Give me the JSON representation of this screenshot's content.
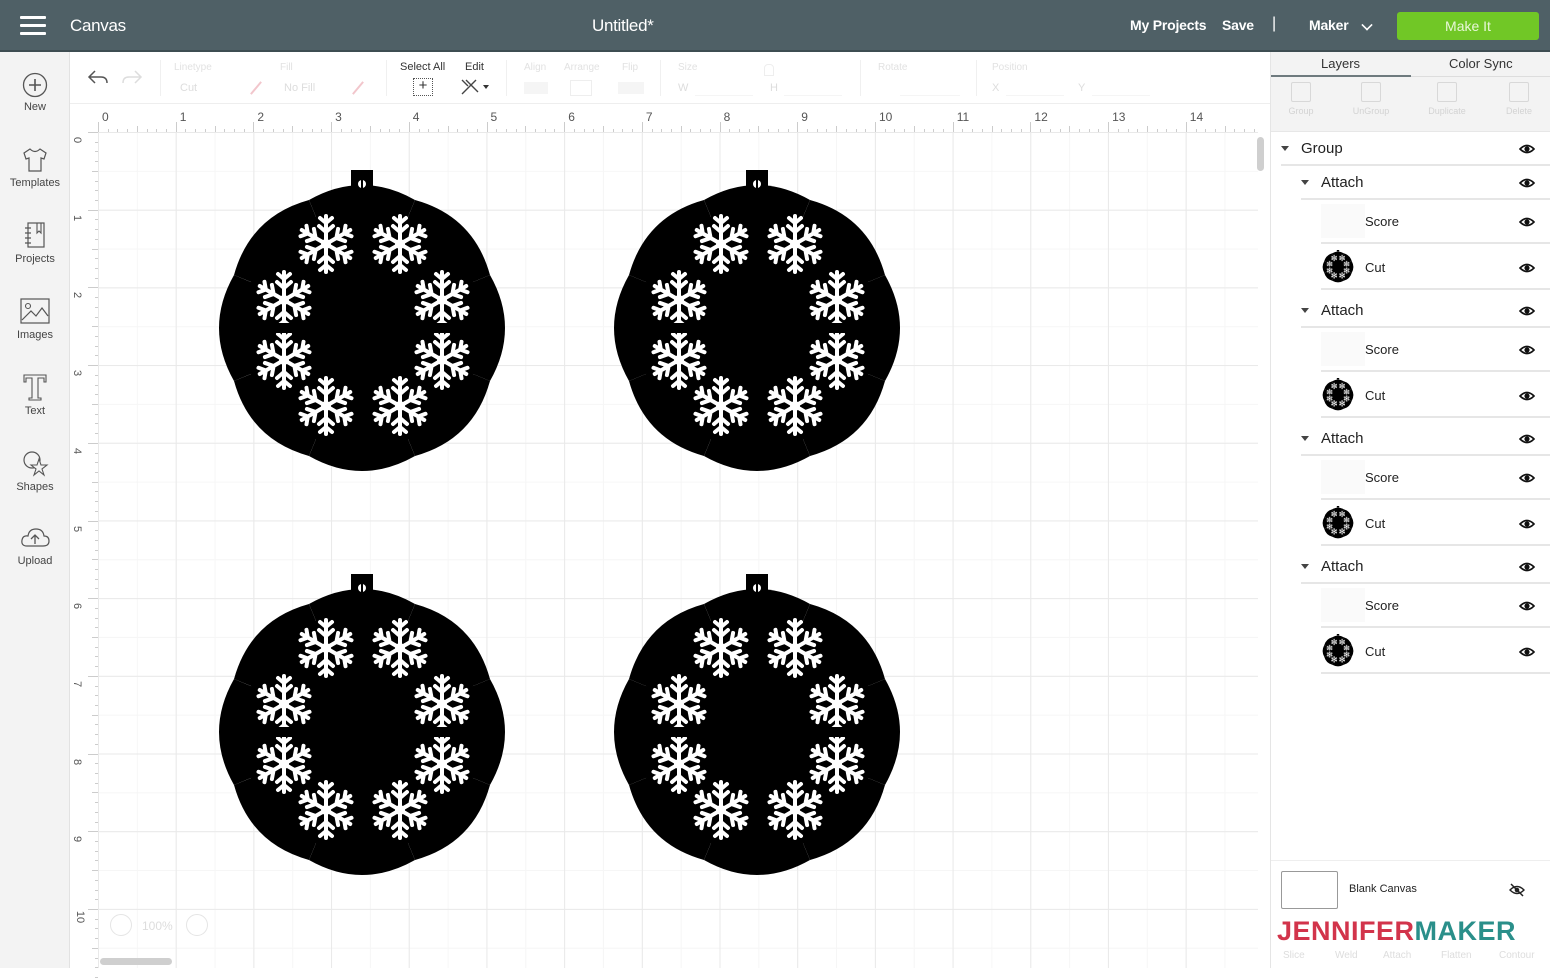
{
  "header": {
    "app_title": "Canvas",
    "doc_title": "Untitled*",
    "my_projects": "My Projects",
    "save": "Save",
    "separator": "|",
    "machine": "Maker",
    "make_it": "Make It",
    "make_it_color": "#71c726",
    "bar_color": "#4f6066"
  },
  "sidebar": {
    "items": [
      {
        "label": "New",
        "icon": "plus-circle-icon"
      },
      {
        "label": "Templates",
        "icon": "tshirt-icon"
      },
      {
        "label": "Projects",
        "icon": "notebook-icon"
      },
      {
        "label": "Images",
        "icon": "image-icon"
      },
      {
        "label": "Text",
        "icon": "text-t-icon"
      },
      {
        "label": "Shapes",
        "icon": "shapes-icon"
      },
      {
        "label": "Upload",
        "icon": "cloud-upload-icon"
      }
    ]
  },
  "toolbar": {
    "linetype_label": "Linetype",
    "linetype_value": "Cut",
    "fill_label": "Fill",
    "fill_value": "No Fill",
    "select_all": "Select All",
    "edit": "Edit",
    "align": "Align",
    "arrange": "Arrange",
    "flip": "Flip",
    "size": "Size",
    "size_w": "W",
    "size_h": "H",
    "rotate": "Rotate",
    "position": "Position",
    "pos_x": "X",
    "pos_y": "Y"
  },
  "rulers": {
    "horizontal": [
      "0",
      "1",
      "2",
      "3",
      "4",
      "5",
      "6",
      "7",
      "8",
      "9",
      "10",
      "11",
      "12",
      "13",
      "14"
    ],
    "vertical": [
      "0",
      "1",
      "2",
      "3",
      "4",
      "5",
      "6",
      "7",
      "8",
      "9",
      "10"
    ]
  },
  "canvas": {
    "zoom_level": "100%",
    "ornament_count": 4
  },
  "layers_panel": {
    "tabs": [
      "Layers",
      "Color Sync"
    ],
    "active_tab": "Layers",
    "actions": [
      "Group",
      "UnGroup",
      "Duplicate",
      "Delete"
    ],
    "tree": {
      "label": "Group",
      "children": [
        {
          "label": "Attach",
          "children": [
            {
              "label": "Score"
            },
            {
              "label": "Cut"
            }
          ]
        },
        {
          "label": "Attach",
          "children": [
            {
              "label": "Score"
            },
            {
              "label": "Cut"
            }
          ]
        },
        {
          "label": "Attach",
          "children": [
            {
              "label": "Score"
            },
            {
              "label": "Cut"
            }
          ]
        },
        {
          "label": "Attach",
          "children": [
            {
              "label": "Score"
            },
            {
              "label": "Cut"
            }
          ]
        }
      ]
    },
    "blank_canvas_label": "Blank Canvas",
    "bottom_actions": [
      "Slice",
      "Weld",
      "Attach",
      "Flatten",
      "Contour"
    ]
  },
  "watermark": {
    "part1": "JENNIFER",
    "part2": "MAKER",
    "color1": "#d2344b",
    "color2": "#2a8f8a"
  }
}
